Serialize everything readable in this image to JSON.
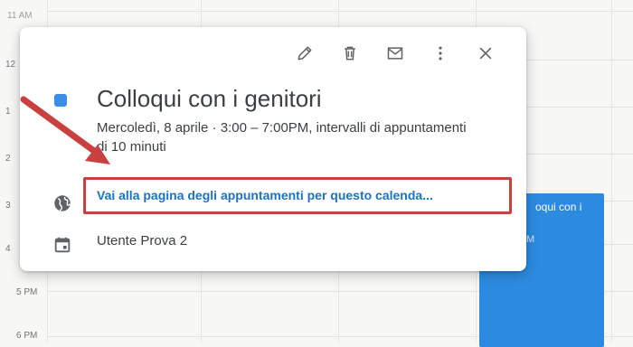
{
  "time_labels": [
    "11 AM",
    "12",
    "1",
    "2",
    "3",
    "4",
    "5 PM",
    "6 PM"
  ],
  "background_event": {
    "title": "oqui con i",
    "subtitle": "M"
  },
  "popup": {
    "title": "Colloqui con i genitori",
    "time_text": "Mercoledì, 8 aprile  ·  3:00 – 7:00PM, intervalli di appuntamenti di 10 minuti",
    "booking_link": "Vai alla pagina degli appuntamenti per questo calenda...",
    "calendar_owner": "Utente Prova 2",
    "color": "#3a8ee6",
    "toolbar_icons": [
      "edit-icon",
      "delete-icon",
      "email-icon",
      "more-options-icon",
      "close-icon"
    ]
  },
  "colors": {
    "link": "#1a73c7",
    "highlight_box": "#c8413f",
    "annotation_arrow": "#c8413f",
    "event_block": "#2c8be0"
  }
}
